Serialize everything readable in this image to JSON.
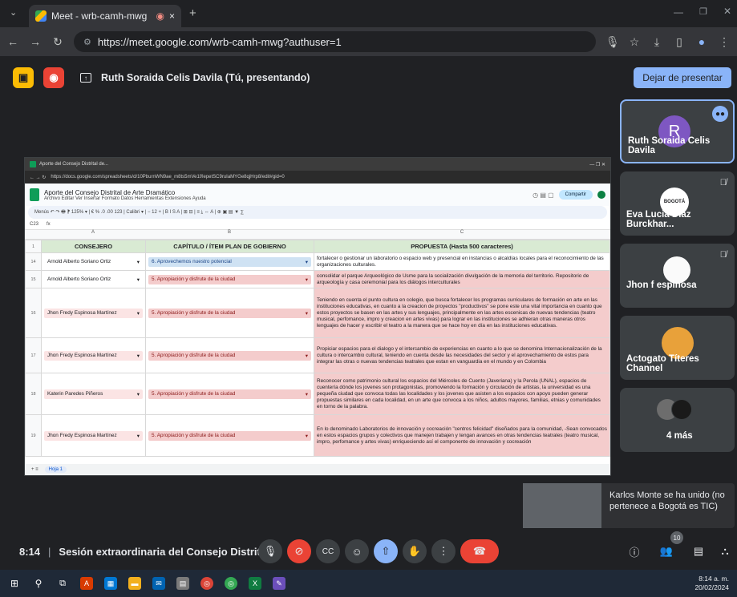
{
  "browser": {
    "tab_title": "Meet - wrb-camh-mwg",
    "tab_close": "×",
    "tab_new": "+",
    "url": "https://meet.google.com/wrb-camh-mwg?authuser=1"
  },
  "present_bar": {
    "presenter_label": "Ruth Soraida Celis Davila (Tú, presentando)",
    "stop_button": "Dejar de presentar"
  },
  "shared_window": {
    "tab_title": "Aporte del Consejo Distrital de...",
    "url": "https://docs.google.com/spreadsheets/d/10PburnWN9ae_m8ts5mVe1f/lepetSC9ruIaMYGe8qjHrp8/edit#gid=0",
    "sheet_title": "Aporte del Consejo Distrital de Arte Dramático",
    "menu": "Archivo  Editar  Ver  Insertar  Formato  Datos  Herramientas  Extensiones  Ayuda",
    "share_label": "Compartir",
    "toolbar": "Menús   ↶  ↷  🖶  ⁋  125%  ▾  |  €  %  .0  .00  123  |  Calibri  ▾  |  −  12  +  |  B  I  S  A  |  ⊞  ⊟  |  ≡  ⤓  ⇔  A  |  ⊕  ▣  ▤  ▼  ∑",
    "cell_ref": "C23",
    "fx": "fx",
    "col_letters": [
      "A",
      "B",
      "C"
    ],
    "headers": [
      "CONSEJERO",
      "CAPÍTULO / ÍTEM PLAN DE GOBIERNO",
      "PROPUESTA (Hasta 500 caracteres)"
    ],
    "rows": [
      {
        "n": "14",
        "consejero": "Arnold Alberto Soriano Ortiz",
        "capitulo": "6. Aprovechemos nuestro potencial",
        "propuesta": "fortalecer o gestionar un laboratorio o espacio web y presencial en instancias o alcaldías locales para el reconocimiento de las organizaciones culturales."
      },
      {
        "n": "15",
        "consejero": "Arnold Alberto Soriano Ortiz",
        "capitulo": "5. Apropiación y disfrute de la ciudad",
        "propuesta": "consolidar el parque Arqueológico de Usme para la socialización divulgación de la memoria del territorio. Repositorio de arqueología y casa ceremonial para los diálogos interculturales"
      },
      {
        "n": "16",
        "consejero": "Jhon Fredy Espinosa Martínez",
        "capitulo": "5. Apropiación y disfrute de la ciudad",
        "propuesta": "Teniendo en cuenta el punto cultura en colegio, que busca fortalecer los programas curriculares de formación en arte en las instituciones educativas, en cuanto a la creacion de proyectos \"productivos\" se pone este una vital importancia en cuanto que estos proyectos se basen en las artes y sus lenguajes, principalmente en las artes escenicas de nuevas tendencias (teatro musical, perfomance, impro y creacion en artes vivas) para lograr en las instituciones se adhieran otras maneras otros lenguajes de hacer y escribir el teatro a la manera que se hace hoy en día en las instituciones educativas."
      },
      {
        "n": "17",
        "consejero": "Jhon Fredy Espinosa Martínez",
        "capitulo": "5. Apropiación y disfrute de la ciudad",
        "propuesta": "Propiciar espacios para el dialogo y el intercambio de experiencias en cuanto a lo que se denomina Internacionalización de la cultura o intercambio cultural, teniendo en cuenta desde las necesidades del sector y el aprovechamiento de estos para integrar las otras o nuevas tendencias teatrales que estan en vanguardia en el mundo y en Colombia"
      },
      {
        "n": "18",
        "consejero": "Katerin Paredes Piñeros",
        "capitulo": "5. Apropiación y disfrute de la ciudad",
        "propuesta": "Reconocer como patrimonio cultural los espacios del Miércoles de Cuento (Javeriana) y la Perola (UNAL), espacios de cuentería dónde los jovenes son protagonistas, promoviendo la formación y circulación de artistas, la universidad es una pequeña ciudad que convoca todas las localidades y los jovenes que asisten a los espacios con apoyo pueden generar propuestas similares en cada localidad, en un arte que convoca a los niños, adultos mayores, familias, etnias y comunidades en torno de la palabra."
      },
      {
        "n": "19",
        "consejero": "Jhon Fredy Espinosa Martínez",
        "capitulo": "5. Apropiación y disfrute de la ciudad",
        "propuesta": "En lo denominado Laboratorios de innovación y cocreación \"centros felicidad\" diseñados para la comunidad, -Sean convocados en estos espacios grupos y colectivos que manejen trabajen y tengan avances en otras tendencias teatrales (teatro musical, impro, perfomance y artes vivas) enriqueciendo así el componente de innovación y cocreación"
      }
    ],
    "sheet_tab": "Hoja 1"
  },
  "participants": [
    {
      "name": "Ruth Soraida Celis Davila",
      "initial": "R"
    },
    {
      "name": "Eva Lucia Diaz Burckhar...",
      "logo_text": "BOGOTÁ"
    },
    {
      "name": "Jhon f espinosa"
    },
    {
      "name": "Actogato Títeres Channel"
    },
    {
      "name": "4 más"
    }
  ],
  "toast": {
    "message": "Karlos Monte se ha unido (no pertenece a Bogotá es TIC)"
  },
  "controls": {
    "time": "8:14",
    "separator": "|",
    "meeting_title": "Sesión extraordinaria del Consejo Distrital ...",
    "people_count": "10"
  },
  "taskbar": {
    "clock": "8:14 a. m.",
    "date": "20/02/2024"
  },
  "colors": {
    "bg": "#202124",
    "accent": "#8ab4f8",
    "end_call": "#ea4335",
    "sheet_red": "#f4cccc",
    "sheet_header": "#d9ead3"
  }
}
